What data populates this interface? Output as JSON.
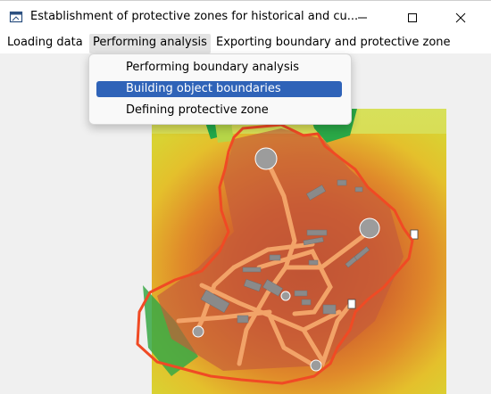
{
  "window": {
    "title": "Establishment of protective zones for historical and cu...",
    "icon": "app-window-icon",
    "controls": [
      "minimize-icon",
      "maximize-icon",
      "close-icon"
    ]
  },
  "menubar": {
    "items": [
      {
        "label": "Loading data"
      },
      {
        "label": "Performing analysis",
        "active": true
      },
      {
        "label": "Exporting boundary and protective zone"
      }
    ]
  },
  "dropdown": {
    "items": [
      {
        "label": "Performing boundary analysis"
      },
      {
        "label": "Building object boundaries",
        "selected": true
      },
      {
        "label": "Defining protective zone"
      }
    ]
  },
  "colors": {
    "selection": "#2f63b8",
    "boundary": "#f04a24",
    "terrain_low": "#1aa23c",
    "terrain_mid": "#e7d02a",
    "terrain_high": "#c8522a",
    "object": "#8a8a8a"
  }
}
